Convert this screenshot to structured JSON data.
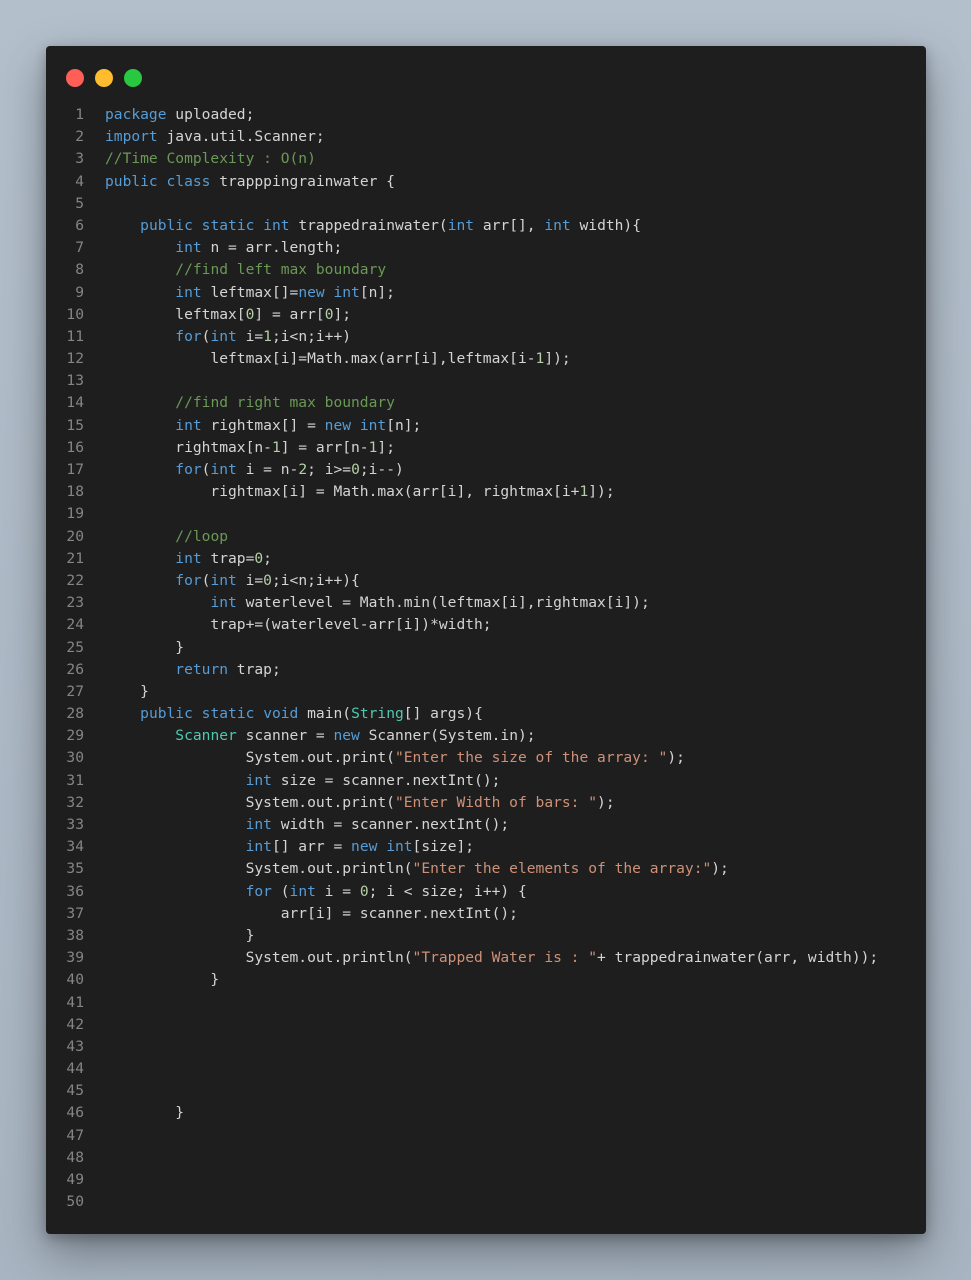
{
  "window": {
    "controls": [
      {
        "name": "close",
        "color": "#ff5f57"
      },
      {
        "name": "minimize",
        "color": "#febc2e"
      },
      {
        "name": "zoom",
        "color": "#28c840"
      }
    ]
  },
  "colors": {
    "background": "#1e1e1e",
    "keyword": "#569cd6",
    "type": "#4ec9b0",
    "string": "#ce9178",
    "comment": "#6a9955",
    "number": "#b5cea8",
    "plain": "#d4d4d4",
    "line_number": "#858585"
  },
  "code": {
    "language": "java",
    "lines": [
      {
        "n": "1",
        "tokens": [
          [
            "kw",
            "package"
          ],
          [
            "pl",
            " uploaded;"
          ]
        ]
      },
      {
        "n": "2",
        "tokens": [
          [
            "kw",
            "import"
          ],
          [
            "pl",
            " java.util.Scanner;"
          ]
        ]
      },
      {
        "n": "3",
        "tokens": [
          [
            "com",
            "//Time Complexity : O(n)"
          ]
        ]
      },
      {
        "n": "4",
        "tokens": [
          [
            "kw",
            "public"
          ],
          [
            "pl",
            " "
          ],
          [
            "kw",
            "class"
          ],
          [
            "pl",
            " trapppingrainwater {"
          ]
        ]
      },
      {
        "n": "5",
        "tokens": []
      },
      {
        "n": "6",
        "tokens": [
          [
            "pl",
            "    "
          ],
          [
            "kw",
            "public"
          ],
          [
            "pl",
            " "
          ],
          [
            "kw",
            "static"
          ],
          [
            "pl",
            " "
          ],
          [
            "kw",
            "int"
          ],
          [
            "pl",
            " trappedrainwater("
          ],
          [
            "kw",
            "int"
          ],
          [
            "pl",
            " arr[], "
          ],
          [
            "kw",
            "int"
          ],
          [
            "pl",
            " width){"
          ]
        ]
      },
      {
        "n": "7",
        "tokens": [
          [
            "pl",
            "        "
          ],
          [
            "kw",
            "int"
          ],
          [
            "pl",
            " n = arr.length;"
          ]
        ]
      },
      {
        "n": "8",
        "tokens": [
          [
            "pl",
            "        "
          ],
          [
            "com",
            "//find left max boundary"
          ]
        ]
      },
      {
        "n": "9",
        "tokens": [
          [
            "pl",
            "        "
          ],
          [
            "kw",
            "int"
          ],
          [
            "pl",
            " leftmax[]="
          ],
          [
            "kw",
            "new"
          ],
          [
            "pl",
            " "
          ],
          [
            "kw",
            "int"
          ],
          [
            "pl",
            "[n];"
          ]
        ]
      },
      {
        "n": "10",
        "tokens": [
          [
            "pl",
            "        leftmax["
          ],
          [
            "num",
            "0"
          ],
          [
            "pl",
            "] = arr["
          ],
          [
            "num",
            "0"
          ],
          [
            "pl",
            "];"
          ]
        ]
      },
      {
        "n": "11",
        "tokens": [
          [
            "pl",
            "        "
          ],
          [
            "kw",
            "for"
          ],
          [
            "pl",
            "("
          ],
          [
            "kw",
            "int"
          ],
          [
            "pl",
            " i="
          ],
          [
            "num",
            "1"
          ],
          [
            "pl",
            ";i<n;i++)"
          ]
        ]
      },
      {
        "n": "12",
        "tokens": [
          [
            "pl",
            "            leftmax[i]=Math.max(arr[i],leftmax[i-"
          ],
          [
            "num",
            "1"
          ],
          [
            "pl",
            "]);"
          ]
        ]
      },
      {
        "n": "13",
        "tokens": []
      },
      {
        "n": "14",
        "tokens": [
          [
            "pl",
            "        "
          ],
          [
            "com",
            "//find right max boundary"
          ]
        ]
      },
      {
        "n": "15",
        "tokens": [
          [
            "pl",
            "        "
          ],
          [
            "kw",
            "int"
          ],
          [
            "pl",
            " rightmax[] = "
          ],
          [
            "kw",
            "new"
          ],
          [
            "pl",
            " "
          ],
          [
            "kw",
            "int"
          ],
          [
            "pl",
            "[n];"
          ]
        ]
      },
      {
        "n": "16",
        "tokens": [
          [
            "pl",
            "        rightmax[n-"
          ],
          [
            "num",
            "1"
          ],
          [
            "pl",
            "] = arr[n-"
          ],
          [
            "num",
            "1"
          ],
          [
            "pl",
            "];"
          ]
        ]
      },
      {
        "n": "17",
        "tokens": [
          [
            "pl",
            "        "
          ],
          [
            "kw",
            "for"
          ],
          [
            "pl",
            "("
          ],
          [
            "kw",
            "int"
          ],
          [
            "pl",
            " i = n-"
          ],
          [
            "num",
            "2"
          ],
          [
            "pl",
            "; i>="
          ],
          [
            "num",
            "0"
          ],
          [
            "pl",
            ";i--)"
          ]
        ]
      },
      {
        "n": "18",
        "tokens": [
          [
            "pl",
            "            rightmax[i] = Math.max(arr[i], rightmax[i+"
          ],
          [
            "num",
            "1"
          ],
          [
            "pl",
            "]);"
          ]
        ]
      },
      {
        "n": "19",
        "tokens": []
      },
      {
        "n": "20",
        "tokens": [
          [
            "pl",
            "        "
          ],
          [
            "com",
            "//loop"
          ]
        ]
      },
      {
        "n": "21",
        "tokens": [
          [
            "pl",
            "        "
          ],
          [
            "kw",
            "int"
          ],
          [
            "pl",
            " trap="
          ],
          [
            "num",
            "0"
          ],
          [
            "pl",
            ";"
          ]
        ]
      },
      {
        "n": "22",
        "tokens": [
          [
            "pl",
            "        "
          ],
          [
            "kw",
            "for"
          ],
          [
            "pl",
            "("
          ],
          [
            "kw",
            "int"
          ],
          [
            "pl",
            " i="
          ],
          [
            "num",
            "0"
          ],
          [
            "pl",
            ";i<n;i++){"
          ]
        ]
      },
      {
        "n": "23",
        "tokens": [
          [
            "pl",
            "            "
          ],
          [
            "kw",
            "int"
          ],
          [
            "pl",
            " waterlevel = Math.min(leftmax[i],rightmax[i]);"
          ]
        ]
      },
      {
        "n": "24",
        "tokens": [
          [
            "pl",
            "            trap+=(waterlevel-arr[i])*width;"
          ]
        ]
      },
      {
        "n": "25",
        "tokens": [
          [
            "pl",
            "        }"
          ]
        ]
      },
      {
        "n": "26",
        "tokens": [
          [
            "pl",
            "        "
          ],
          [
            "kw",
            "return"
          ],
          [
            "pl",
            " trap;"
          ]
        ]
      },
      {
        "n": "27",
        "tokens": [
          [
            "pl",
            "    }"
          ]
        ]
      },
      {
        "n": "28",
        "tokens": [
          [
            "pl",
            "    "
          ],
          [
            "kw",
            "public"
          ],
          [
            "pl",
            " "
          ],
          [
            "kw",
            "static"
          ],
          [
            "pl",
            " "
          ],
          [
            "kw",
            "void"
          ],
          [
            "pl",
            " main("
          ],
          [
            "cls",
            "String"
          ],
          [
            "pl",
            "[] args){"
          ]
        ]
      },
      {
        "n": "29",
        "tokens": [
          [
            "pl",
            "        "
          ],
          [
            "cls",
            "Scanner"
          ],
          [
            "pl",
            " scanner = "
          ],
          [
            "kw",
            "new"
          ],
          [
            "pl",
            " Scanner(System.in);"
          ]
        ]
      },
      {
        "n": "30",
        "tokens": [
          [
            "pl",
            "                System.out.print("
          ],
          [
            "str",
            "\"Enter the size of the array: \""
          ],
          [
            "pl",
            ");"
          ]
        ]
      },
      {
        "n": "31",
        "tokens": [
          [
            "pl",
            "                "
          ],
          [
            "kw",
            "int"
          ],
          [
            "pl",
            " size = scanner.nextInt();"
          ]
        ]
      },
      {
        "n": "32",
        "tokens": [
          [
            "pl",
            "                System.out.print("
          ],
          [
            "str",
            "\"Enter Width of bars: \""
          ],
          [
            "pl",
            ");"
          ]
        ]
      },
      {
        "n": "33",
        "tokens": [
          [
            "pl",
            "                "
          ],
          [
            "kw",
            "int"
          ],
          [
            "pl",
            " width = scanner.nextInt();"
          ]
        ]
      },
      {
        "n": "34",
        "tokens": [
          [
            "pl",
            "                "
          ],
          [
            "kw",
            "int"
          ],
          [
            "pl",
            "[] arr = "
          ],
          [
            "kw",
            "new"
          ],
          [
            "pl",
            " "
          ],
          [
            "kw",
            "int"
          ],
          [
            "pl",
            "[size];"
          ]
        ]
      },
      {
        "n": "35",
        "tokens": [
          [
            "pl",
            "                System.out.println("
          ],
          [
            "str",
            "\"Enter the elements of the array:\""
          ],
          [
            "pl",
            ");"
          ]
        ]
      },
      {
        "n": "36",
        "tokens": [
          [
            "pl",
            "                "
          ],
          [
            "kw",
            "for"
          ],
          [
            "pl",
            " ("
          ],
          [
            "kw",
            "int"
          ],
          [
            "pl",
            " i = "
          ],
          [
            "num",
            "0"
          ],
          [
            "pl",
            "; i < size; i++) {"
          ]
        ]
      },
      {
        "n": "37",
        "tokens": [
          [
            "pl",
            "                    arr[i] = scanner.nextInt();"
          ]
        ]
      },
      {
        "n": "38",
        "tokens": [
          [
            "pl",
            "                }"
          ]
        ]
      },
      {
        "n": "39",
        "tokens": [
          [
            "pl",
            "                System.out.println("
          ],
          [
            "str",
            "\"Trapped Water is : \""
          ],
          [
            "pl",
            "+ trappedrainwater(arr, width));"
          ]
        ]
      },
      {
        "n": "40",
        "tokens": [
          [
            "pl",
            "            }"
          ]
        ]
      },
      {
        "n": "41",
        "tokens": []
      },
      {
        "n": "42",
        "tokens": []
      },
      {
        "n": "43",
        "tokens": []
      },
      {
        "n": "44",
        "tokens": []
      },
      {
        "n": "45",
        "tokens": []
      },
      {
        "n": "46",
        "tokens": [
          [
            "pl",
            "        }"
          ]
        ]
      },
      {
        "n": "47",
        "tokens": []
      },
      {
        "n": "48",
        "tokens": []
      },
      {
        "n": "49",
        "tokens": []
      },
      {
        "n": "50",
        "tokens": []
      }
    ]
  }
}
